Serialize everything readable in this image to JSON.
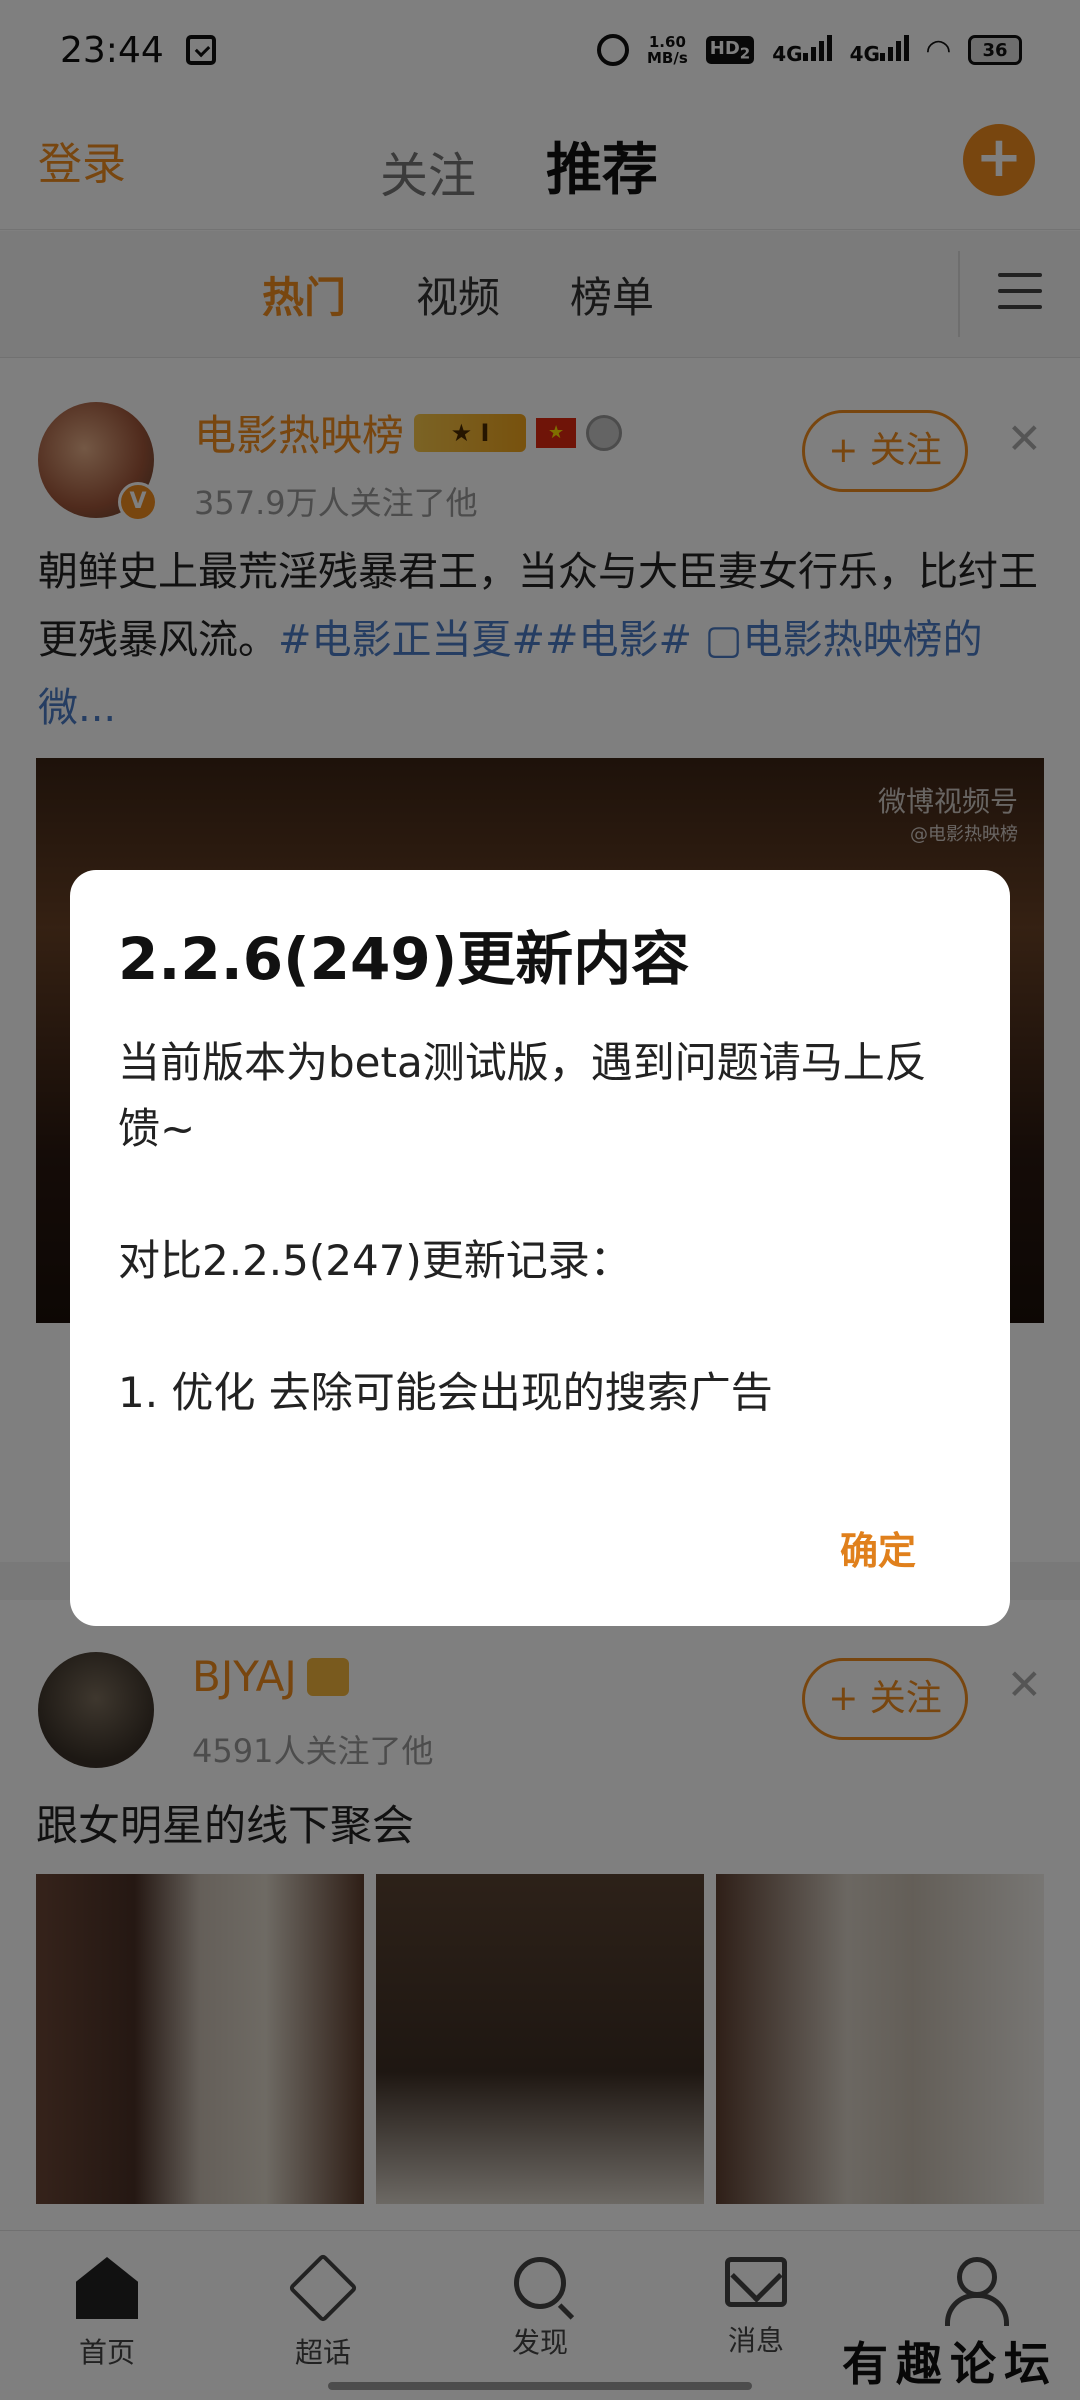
{
  "status_bar": {
    "time": "23:44",
    "net_speed": "1.60",
    "net_unit": "MB/s",
    "hd": "HD",
    "hd_sub": "2",
    "sig1": "4G",
    "sig2": "4G",
    "battery": "36"
  },
  "top_nav": {
    "login": "登录",
    "tabs": [
      "关注",
      "推荐"
    ],
    "active_tab": "推荐"
  },
  "sub_nav": {
    "tabs": [
      "热门",
      "视频",
      "榜单"
    ],
    "active": "热门"
  },
  "post1": {
    "username": "电影热映榜",
    "badge_level": "I",
    "followers": "357.9万人关注了他",
    "follow_label": "+ 关注",
    "text_a": "朝鲜史上最荒淫残暴君王，当众与大臣妻女行乐，比纣王更残暴风流。",
    "hashtags": "#电影正当夏##电影#",
    "text_b": " ▢电影热映榜的微...",
    "watermark": "微博视频号",
    "watermark_sub": "@电影热映榜"
  },
  "post2": {
    "username": "BJYAJ",
    "followers": "4591人关注了他",
    "follow_label": "+ 关注",
    "text": "跟女明星的线下聚会"
  },
  "bottom_nav": [
    {
      "label": "首页"
    },
    {
      "label": "超话"
    },
    {
      "label": "发现"
    },
    {
      "label": "消息"
    },
    {
      "label": ""
    }
  ],
  "forum_mark": "有趣论坛",
  "dialog": {
    "title": "2.2.6(249)更新内容",
    "line1": "当前版本为beta测试版，遇到问题请马上反馈~",
    "line2": "对比2.2.5(247)更新记录：",
    "line3": "1. 优化 去除可能会出现的搜索广告",
    "ok": "确定"
  }
}
